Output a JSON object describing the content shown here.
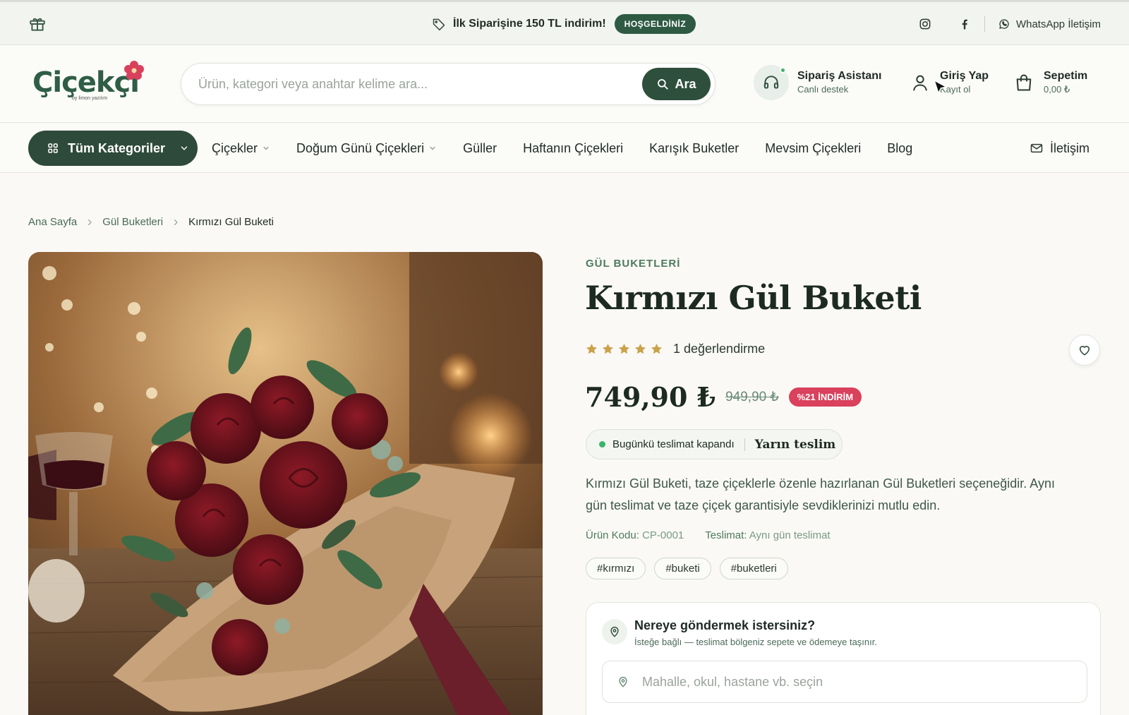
{
  "topbar": {
    "promo_text": "İlk Siparişine 150 TL indirim!",
    "promo_badge": "HOŞGELDİNİZ",
    "whatsapp_label": "WhatsApp İletişim",
    "icons": [
      "gift-icon",
      "tag-icon",
      "instagram-icon",
      "facebook-icon",
      "whatsapp-icon"
    ]
  },
  "header": {
    "logo_text": "Çiçekçi",
    "logo_sub": "by limon yazılım",
    "search": {
      "placeholder": "Ürün, kategori veya anahtar kelime ara...",
      "button_label": "Ara"
    },
    "assistant": {
      "title": "Sipariş Asistanı",
      "subtitle": "Canlı destek"
    },
    "login": {
      "title": "Giriş Yap",
      "subtitle": "Kayıt ol"
    },
    "cart": {
      "title": "Sepetim",
      "amount": "0,00 ₺"
    }
  },
  "nav": {
    "all_categories": "Tüm Kategoriler",
    "items": [
      {
        "label": "Çiçekler",
        "has_dropdown": true
      },
      {
        "label": "Doğum Günü Çiçekleri",
        "has_dropdown": true
      },
      {
        "label": "Güller",
        "has_dropdown": false
      },
      {
        "label": "Haftanın Çiçekleri",
        "has_dropdown": false
      },
      {
        "label": "Karışık Buketler",
        "has_dropdown": false
      },
      {
        "label": "Mevsim Çiçekleri",
        "has_dropdown": false
      },
      {
        "label": "Blog",
        "has_dropdown": false
      }
    ],
    "contact": "İletişim"
  },
  "breadcrumb": [
    "Ana Sayfa",
    "Gül Buketleri",
    "Kırmızı Gül Buketi"
  ],
  "product": {
    "category": "GÜL BUKETLERİ",
    "title": "Kırmızı Gül Buketi",
    "rating": 5,
    "rating_text": "1 değerlendirme",
    "price": "749,90 ₺",
    "old_price": "949,90 ₺",
    "discount": "%21 İNDİRİM",
    "delivery_status": "Bugünkü teslimat kapandı",
    "delivery_next": "Yarın teslim",
    "description": "Kırmızı Gül Buketi, taze çiçeklerle özenle hazırlanan Gül Buketleri seçeneğidir. Aynı gün teslimat ve taze çiçek garantisiyle sevdiklerinizi mutlu edin.",
    "code_label": "Ürün Kodu:",
    "code_value": "CP-0001",
    "shipping_label": "Teslimat:",
    "shipping_value": "Aynı gün teslimat",
    "tags": [
      "#kırmızı",
      "#buketi",
      "#buketleri"
    ]
  },
  "shipping_box": {
    "title": "Nereye göndermek istersiniz?",
    "subtitle": "İsteğe bağlı — teslimat bölgeniz sepete ve ödemeye taşınır.",
    "placeholder": "Mahalle, okul, hastane vb. seçin"
  },
  "colors": {
    "brand_green": "#2f4f3d",
    "accent_star": "#c9a24a",
    "discount_red": "#d9415c",
    "page_bg": "#faf9f5"
  }
}
